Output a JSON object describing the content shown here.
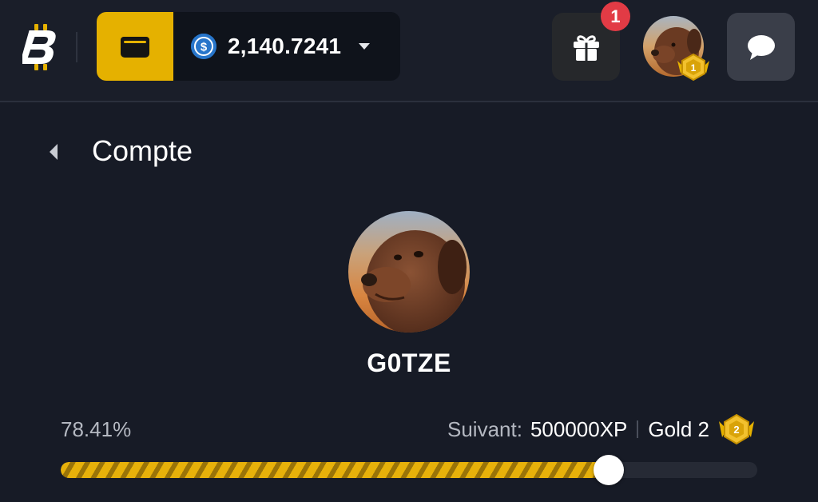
{
  "header": {
    "logo": "bitcoin-b-logo",
    "wallet_icon": "wallet-icon",
    "balance": {
      "currency_icon": "usdc-coin-icon",
      "amount": "2,140.7241"
    },
    "gift_icon": "gift-icon",
    "notification_count": "1",
    "avatar_level": "1",
    "chat_icon": "chat-bubble-icon"
  },
  "page": {
    "title": "Compte"
  },
  "profile": {
    "username": "G0TZE"
  },
  "progress": {
    "percent_label": "78.41%",
    "fraction": 0.7841,
    "next_label": "Suivant:",
    "next_value": "500000XP",
    "tier_name": "Gold 2",
    "tier_level": "2"
  },
  "colors": {
    "accent": "#e5b100",
    "background": "#171b26",
    "badge_red": "#e23b45",
    "usdc_blue": "#2775ca"
  }
}
